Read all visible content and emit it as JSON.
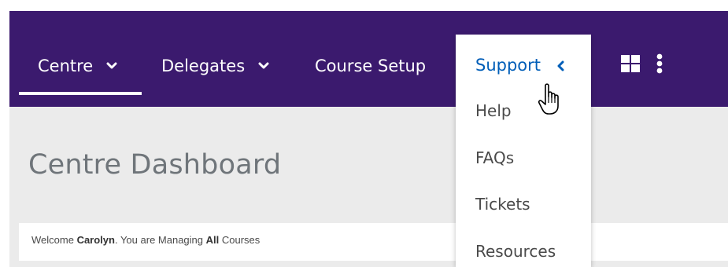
{
  "nav": {
    "items": [
      {
        "label": "Centre",
        "has_dropdown": true,
        "active": true
      },
      {
        "label": "Delegates",
        "has_dropdown": true,
        "active": false
      },
      {
        "label": "Course Setup",
        "has_dropdown": false,
        "active": false
      },
      {
        "label": "Support",
        "has_dropdown": true,
        "open": true
      }
    ],
    "icons": [
      "grid-icon",
      "more-vertical-icon"
    ]
  },
  "dropdown": {
    "header": "Support",
    "items": [
      "Help",
      "FAQs",
      "Tickets",
      "Resources"
    ]
  },
  "page": {
    "title": "Centre Dashboard",
    "welcome": {
      "prefix": "Welcome ",
      "user": "Carolyn",
      "middle": ". You are Managing ",
      "scope": "All",
      "suffix": " Courses"
    }
  },
  "colors": {
    "navbar": "#3b1a6e",
    "link": "#005eb8",
    "content_bg": "#ebebeb",
    "title": "#6f757a"
  }
}
